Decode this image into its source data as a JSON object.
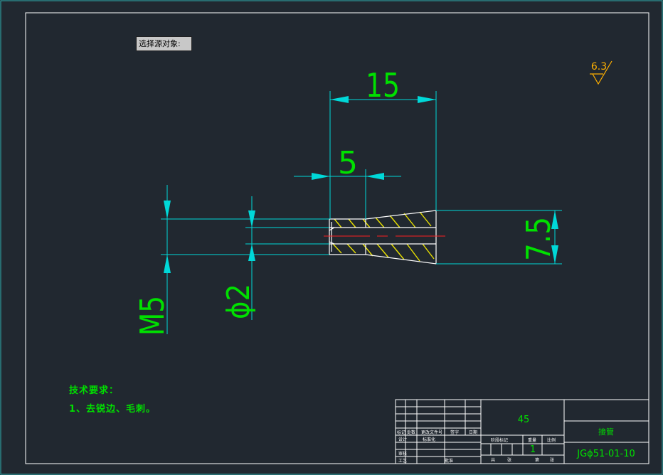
{
  "command_prompt": "选择源对象:",
  "dimensions": {
    "overall_length": "15",
    "thread_length": "5",
    "outer_diameter": "7.5",
    "thread": "M5",
    "bore": "ϕ2"
  },
  "roughness": "6.3",
  "technical_requirements": {
    "title": "技术要求：",
    "item1": "1、去锐边、毛刺。"
  },
  "title_block": {
    "material": "45",
    "part_name": "接管",
    "drawing_number": "JGϕ51-01-10",
    "scale": "1",
    "small_labels": [
      "标记",
      "处数",
      "更改文件号",
      "签字",
      "日期",
      "设计",
      "标准化",
      "审核",
      "工艺",
      "批准",
      "阶段标记",
      "重量",
      "比例",
      "共",
      "张",
      "第",
      "张"
    ]
  },
  "colors": {
    "background": "#212830",
    "frame": "#ffffff",
    "dimension": "#00d8d8",
    "dimension_text": "#00e000",
    "part_outline": "#ffffff",
    "hatch": "#e8e000",
    "centerline": "#ff2020",
    "roughness": "#ffb000"
  }
}
